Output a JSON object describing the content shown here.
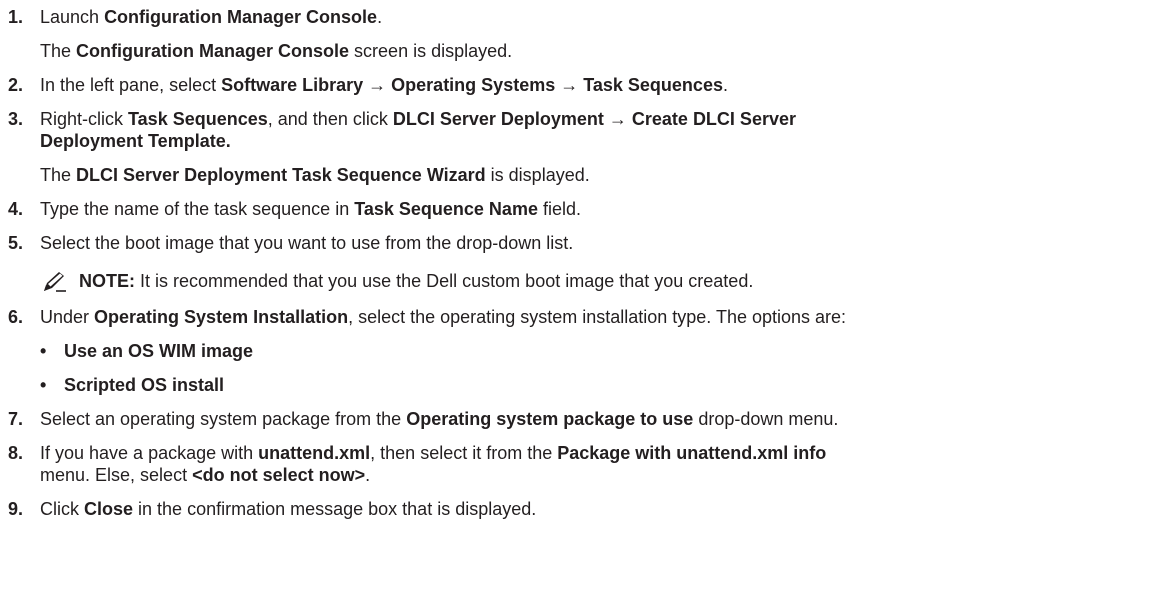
{
  "steps": {
    "s1": {
      "num": "1.",
      "a": "Launch ",
      "b": "Configuration Manager Console",
      "c": ".",
      "sub_a": "The ",
      "sub_b": "Configuration Manager Console",
      "sub_c": " screen is displayed."
    },
    "s2": {
      "num": "2.",
      "a": "In the left pane, select ",
      "b": "Software Library → Operating Systems → Task Sequences",
      "c": "."
    },
    "s3": {
      "num": "3.",
      "a": "Right-click ",
      "b": "Task Sequences",
      "c": ", and then click ",
      "d": "DLCI Server Deployment → Create DLCI Server",
      "e": "Deployment Template.",
      "sub_a": "The ",
      "sub_b": "DLCI Server Deployment Task Sequence Wizard",
      "sub_c": " is displayed."
    },
    "s4": {
      "num": "4.",
      "a": "Type the name of the task sequence in ",
      "b": "Task Sequence Name",
      "c": " field."
    },
    "s5": {
      "num": "5.",
      "a": "Select the boot image that you want to use from the drop-down list.",
      "note_label": "NOTE:",
      "note_text": " It is recommended that you use the Dell custom boot image that you created."
    },
    "s6": {
      "num": "6.",
      "a": "Under ",
      "b": "Operating System Installation",
      "c": ", select the operating system installation type. The options are:",
      "bullets": [
        "Use an OS WIM image",
        "Scripted OS install"
      ],
      "bullet_char": "•"
    },
    "s7": {
      "num": "7.",
      "a": "Select an operating system package from the ",
      "b": "Operating system package to use",
      "c": " drop-down menu."
    },
    "s8": {
      "num": "8.",
      "a": "If you have a package with ",
      "b": "unattend.xml",
      "c": ", then select it from the ",
      "d": "Package with unattend.xml info",
      "e": "menu. Else, select ",
      "f": "<do not select now>",
      "g": "."
    },
    "s9": {
      "num": "9.",
      "a": "Click ",
      "b": "Close",
      "c": " in the confirmation message box that is displayed."
    }
  },
  "icons": {
    "note": "pencil-note-icon"
  }
}
